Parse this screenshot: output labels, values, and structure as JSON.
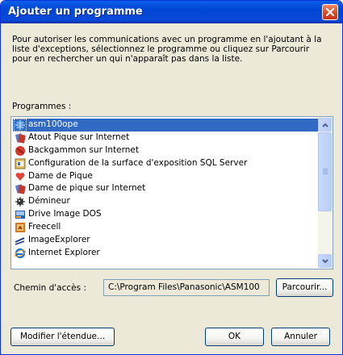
{
  "window": {
    "title": "Ajouter un programme",
    "close_label": "Fermer"
  },
  "description": "Pour autoriser les communications avec un programme en l'ajoutant à la liste d'exceptions, sélectionnez le programme ou cliquez sur Parcourir pour en rechercher un qui n'apparaît pas dans la liste.",
  "programs_label": "Programmes :",
  "programs": [
    {
      "label": "asm100ope",
      "icon": "globe-icon",
      "selected": true
    },
    {
      "label": "Atout Pique sur Internet",
      "icon": "card-game-icon",
      "selected": false
    },
    {
      "label": "Backgammon sur Internet",
      "icon": "backgammon-icon",
      "selected": false
    },
    {
      "label": "Configuration de la surface d'exposition SQL Server",
      "icon": "sql-config-icon",
      "selected": false
    },
    {
      "label": "Dame de Pique",
      "icon": "heart-icon",
      "selected": false
    },
    {
      "label": "Dame de pique sur Internet",
      "icon": "card-game-icon",
      "selected": false
    },
    {
      "label": "Démineur",
      "icon": "minesweeper-icon",
      "selected": false
    },
    {
      "label": "Drive Image DOS",
      "icon": "drive-image-icon",
      "selected": false
    },
    {
      "label": "Freecell",
      "icon": "freecell-icon",
      "selected": false
    },
    {
      "label": "ImageExplorer",
      "icon": "image-explorer-icon",
      "selected": false
    },
    {
      "label": "Internet Explorer",
      "icon": "internet-explorer-icon",
      "selected": false
    }
  ],
  "path": {
    "label": "Chemin d'accès :",
    "value": "C:\\Program Files\\Panasonic\\ASM100"
  },
  "buttons": {
    "browse": "Parcourir...",
    "scope": "Modifier l'étendue...",
    "ok": "OK",
    "cancel": "Annuler"
  },
  "colors": {
    "titlebar": "#0046d5",
    "selection": "#316ac5",
    "window_bg": "#ece9d8",
    "close_button": "#da4a25"
  }
}
